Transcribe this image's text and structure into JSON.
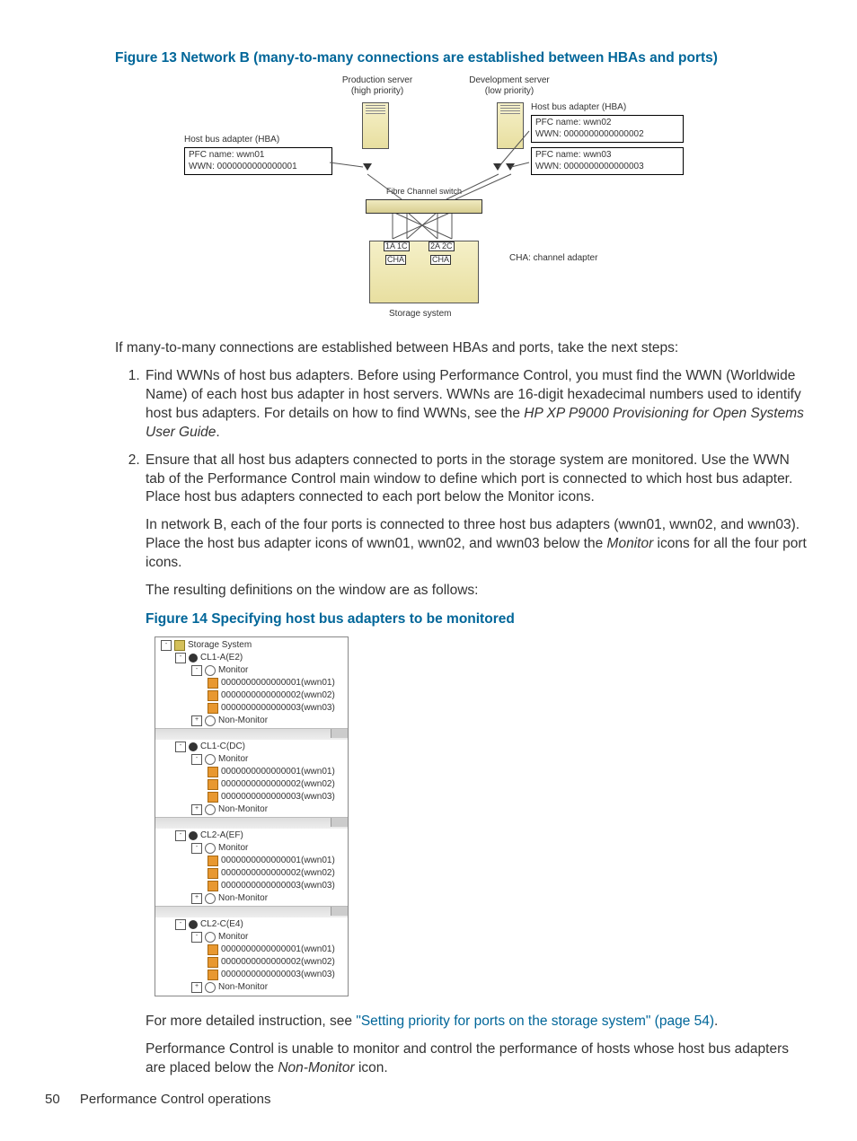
{
  "figure13": {
    "caption": "Figure 13 Network B (many-to-many connections are established between HBAs and ports)",
    "prod_server": "Production server",
    "prod_priority": "(high priority)",
    "dev_server": "Development server",
    "dev_priority": "(low priority)",
    "hba_title": "Host bus adapter (HBA)",
    "hba1_line1": "PFC name: wwn01",
    "hba1_line2": "WWN:      0000000000000001",
    "hba2_line1": "PFC name:  wwn02",
    "hba2_line2": "WWN:        0000000000000002",
    "hba3_line1": "PFC name:  wwn03",
    "hba3_line2": "WWN:        0000000000000003",
    "switch": "Fibre Channel switch",
    "ports_a": "1A 1C",
    "ports_b": "2A 2C",
    "cha": "CHA",
    "cha_note": "CHA: channel adapter",
    "storage": "Storage system"
  },
  "para_intro": "If many-to-many connections are established between HBAs and ports, take the next steps:",
  "step1_a": "Find WWNs of host bus adapters. Before using Performance Control, you must find the WWN (Worldwide Name) of each host bus adapter in host servers. WWNs are 16-digit hexadecimal numbers used to identify host bus adapters. For details on how to find WWNs, see the ",
  "step1_em": "HP XP P9000 Provisioning for Open Systems User Guide",
  "step1_b": ".",
  "step2_a": "Ensure that all host bus adapters connected to ports in the storage system are monitored. Use the WWN tab of the Performance Control main window to define which port is connected to which host bus adapter. Place host bus adapters connected to each port below the Monitor icons.",
  "step2_p2_a": "In network B, each of the four ports is connected to three host bus adapters (wwn01, wwn02, and wwn03). Place the host bus adapter icons of wwn01, wwn02, and wwn03 below the ",
  "step2_p2_em": "Monitor",
  "step2_p2_b": " icons for all the four port icons.",
  "step2_p3": "The resulting definitions on the window are as follows:",
  "figure14": {
    "caption": "Figure 14 Specifying host bus adapters to be monitored"
  },
  "tree": {
    "root": "Storage System",
    "ports": [
      "CL1-A(E2)",
      "CL1-C(DC)",
      "CL2-A(EF)",
      "CL2-C(E4)"
    ],
    "monitor": "Monitor",
    "nonmonitor": "Non-Monitor",
    "wwns": [
      "0000000000000001(wwn01)",
      "0000000000000002(wwn02)",
      "0000000000000003(wwn03)"
    ]
  },
  "closing_a": "For more detailed instruction, see ",
  "closing_link": "\"Setting priority for ports on the storage system\" (page 54)",
  "closing_b": ".",
  "closing2_a": "Performance Control is unable to monitor and control the performance of hosts whose host bus adapters are placed below the ",
  "closing2_em": "Non-Monitor",
  "closing2_b": " icon.",
  "footer": {
    "page": "50",
    "section": "Performance Control operations"
  }
}
